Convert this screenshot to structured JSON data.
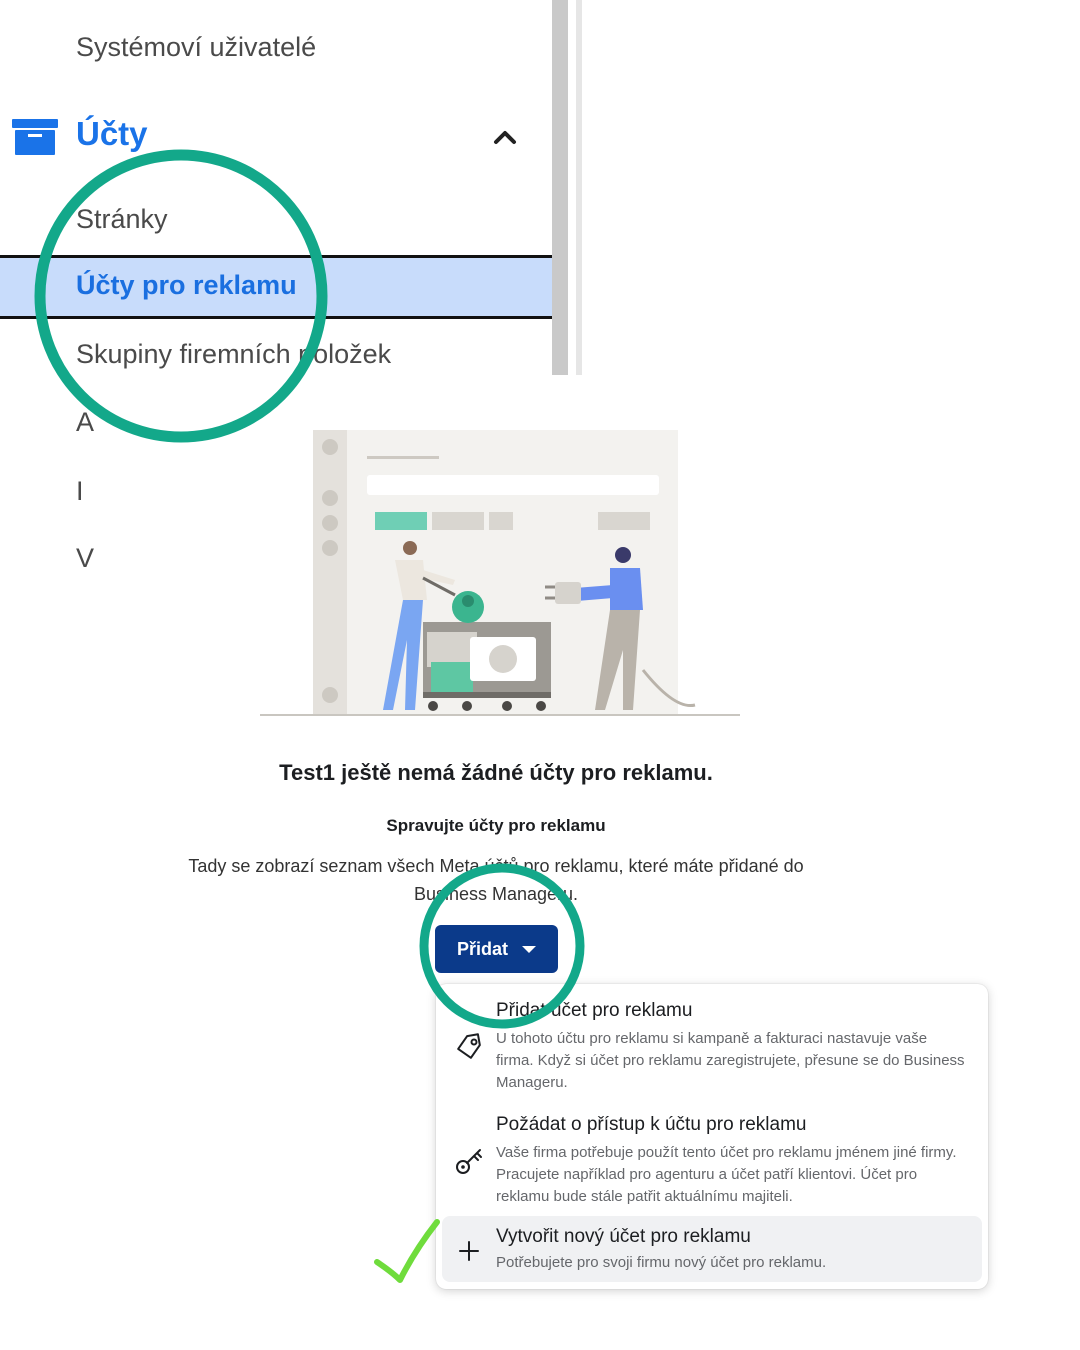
{
  "sidebar": {
    "items_above": [
      "Systémoví uživatelé"
    ],
    "section_title": "Účty",
    "section_icon": "archive-box-icon",
    "chevron_icon": "chevron-up-icon",
    "items": [
      {
        "label": "Stránky"
      },
      {
        "label": "Účty pro reklamu",
        "active": true
      },
      {
        "label": "Skupiny firemních položek"
      }
    ],
    "truncated_items": [
      "A",
      "I",
      "V"
    ]
  },
  "main": {
    "illustration": "two-people-connecting-plug-illustration",
    "empty_title": "Test1 ještě nemá žádné účty pro reklamu.",
    "sub_title": "Spravujte účty pro reklamu",
    "description_line1": "Tady se zobrazí seznam všech Meta účtů pro reklamu, které máte přidané do",
    "description_line2": "Business Manageru.",
    "add_button_label": "Přidat",
    "add_button_icon": "caret-down-icon"
  },
  "menu": {
    "items": [
      {
        "icon": "tag-icon",
        "title": "Přidat účet pro reklamu",
        "description": "U tohoto účtu pro reklamu si kampaně a fakturaci nastavuje vaše firma. Když si účet pro reklamu zaregistrujete, přesune se do Business Manageru."
      },
      {
        "icon": "key-icon",
        "title": "Požádat o přístup k účtu pro reklamu",
        "description": "Vaše firma potřebuje použít tento účet pro reklamu jménem jiné firmy. Pracujete například pro agenturu a účet patří klientovi. Účet pro reklamu bude stále patřit aktuálnímu majiteli."
      },
      {
        "icon": "plus-icon",
        "title": "Vytvořit nový účet pro reklamu",
        "description": "Potřebujete pro svoji firmu nový účet pro reklamu.",
        "highlighted": true
      }
    ]
  },
  "annotations": {
    "circle_color": "#13a88a",
    "checkmark_color": "#6fdc3c"
  },
  "colors": {
    "accent_blue": "#1a73e8",
    "active_row_bg": "#c8dcfb",
    "button_bg": "#0b3a8a"
  }
}
